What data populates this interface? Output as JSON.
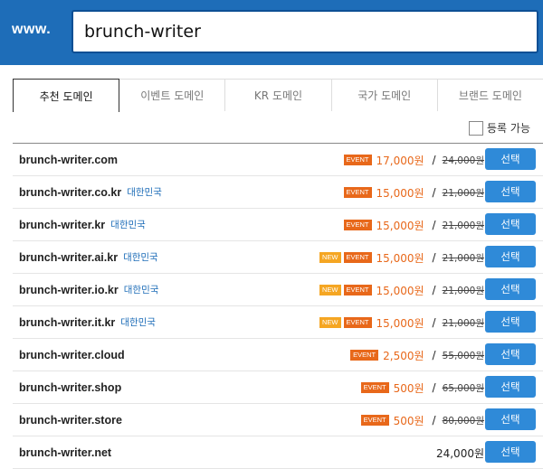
{
  "header": {
    "prefix": "www.",
    "search_value": "brunch-writer"
  },
  "tabs": [
    {
      "label": "추천 도메인",
      "active": true
    },
    {
      "label": "이벤트 도메인"
    },
    {
      "label": "KR 도메인"
    },
    {
      "label": "국가 도메인"
    },
    {
      "label": "브랜드 도메인"
    }
  ],
  "filter": {
    "label": "등록 가능",
    "checked": false
  },
  "select_label": "선택",
  "rows": [
    {
      "domain": "brunch-writer.com",
      "region": "",
      "new": false,
      "event": true,
      "price": "17,000원",
      "orig": "24,000원"
    },
    {
      "domain": "brunch-writer.co.kr",
      "region": "대한민국",
      "new": false,
      "event": true,
      "price": "15,000원",
      "orig": "21,000원"
    },
    {
      "domain": "brunch-writer.kr",
      "region": "대한민국",
      "new": false,
      "event": true,
      "price": "15,000원",
      "orig": "21,000원"
    },
    {
      "domain": "brunch-writer.ai.kr",
      "region": "대한민국",
      "new": true,
      "event": true,
      "price": "15,000원",
      "orig": "21,000원"
    },
    {
      "domain": "brunch-writer.io.kr",
      "region": "대한민국",
      "new": true,
      "event": true,
      "price": "15,000원",
      "orig": "21,000원"
    },
    {
      "domain": "brunch-writer.it.kr",
      "region": "대한민국",
      "new": true,
      "event": true,
      "price": "15,000원",
      "orig": "21,000원"
    },
    {
      "domain": "brunch-writer.cloud",
      "region": "",
      "new": false,
      "event": true,
      "price": "2,500원",
      "orig": "55,000원"
    },
    {
      "domain": "brunch-writer.shop",
      "region": "",
      "new": false,
      "event": true,
      "price": "500원",
      "orig": "65,000원"
    },
    {
      "domain": "brunch-writer.store",
      "region": "",
      "new": false,
      "event": true,
      "price": "500원",
      "orig": "80,000원"
    },
    {
      "domain": "brunch-writer.net",
      "region": "",
      "new": false,
      "event": false,
      "price": "24,000원",
      "orig": ""
    }
  ],
  "badges": {
    "new": "NEW",
    "event": "EVENT"
  },
  "colors": {
    "header": "#1e6db8",
    "event": "#e8681a",
    "new": "#f5a623",
    "button": "#2f8ad8"
  }
}
